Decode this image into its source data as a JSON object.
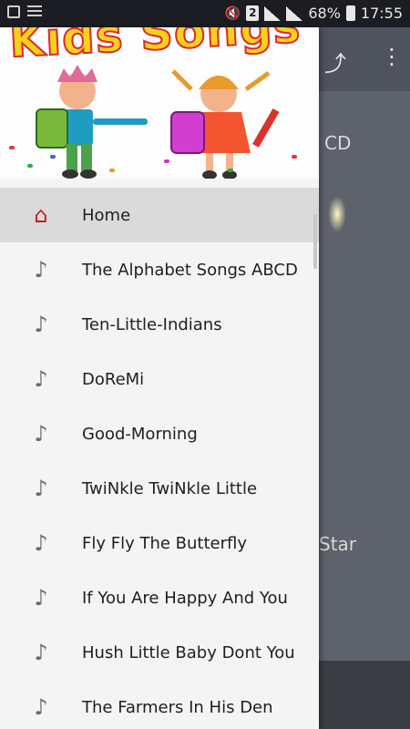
{
  "status_bar": {
    "battery": "68%",
    "time": "17:55",
    "sim_label": "2"
  },
  "app": {
    "visible_text_1": "CD",
    "visible_text_2": "Star"
  },
  "drawer": {
    "header_title": "Kids Songs",
    "items": [
      {
        "label": "Home",
        "icon": "home-icon",
        "active": true
      },
      {
        "label": "The Alphabet Songs ABCD",
        "icon": "music-note-icon"
      },
      {
        "label": "Ten-Little-Indians",
        "icon": "music-note-icon"
      },
      {
        "label": "DoReMi",
        "icon": "music-note-icon"
      },
      {
        "label": "Good-Morning",
        "icon": "music-note-icon"
      },
      {
        "label": "TwiNkle TwiNkle Little",
        "icon": "music-note-icon"
      },
      {
        "label": "Fly Fly The Butterfly",
        "icon": "music-note-icon"
      },
      {
        "label": "If You Are Happy And You",
        "icon": "music-note-icon"
      },
      {
        "label": "Hush Little Baby Dont You",
        "icon": "music-note-icon"
      },
      {
        "label": "The Farmers In His Den",
        "icon": "music-note-icon"
      }
    ]
  },
  "colors": {
    "accent": "#c41f17",
    "drawer_bg": "#f4f4f4",
    "active_bg": "#dadada"
  }
}
